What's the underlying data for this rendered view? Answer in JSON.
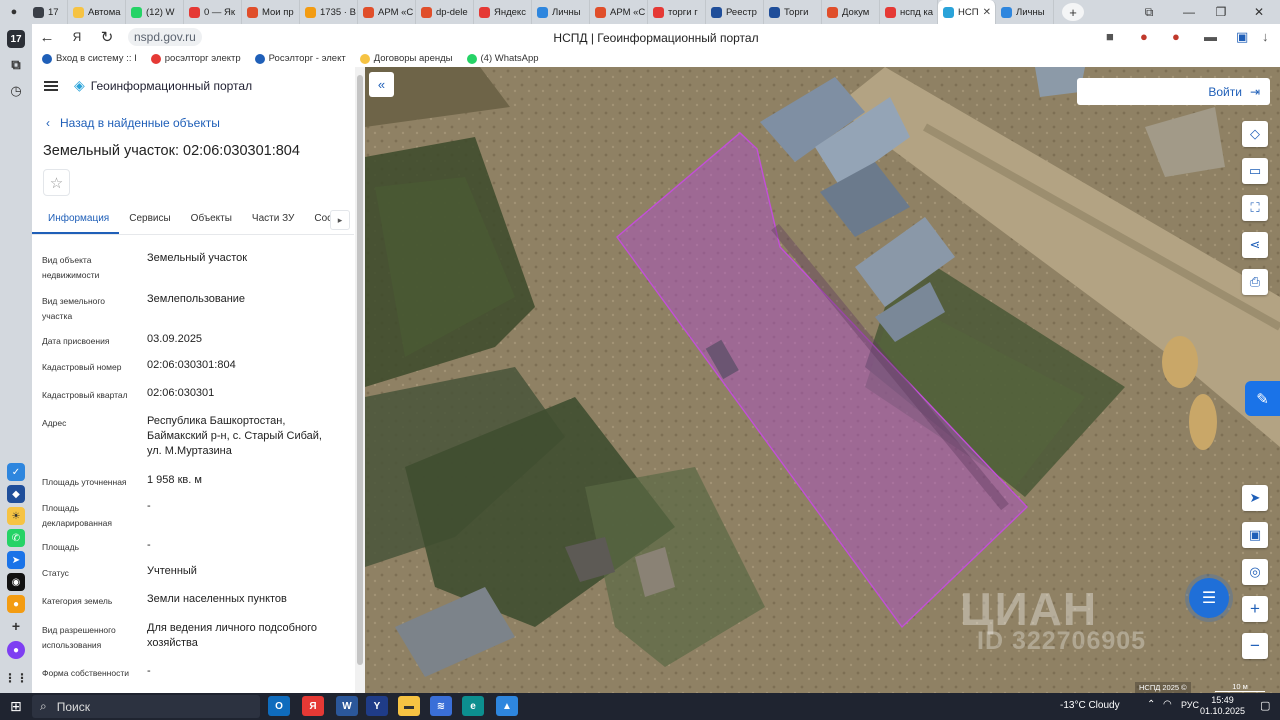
{
  "browser": {
    "tabs": [
      {
        "label": "17",
        "color": "#3a3f47"
      },
      {
        "label": "Автома",
        "color": "#f6c343"
      },
      {
        "label": "(12) W",
        "color": "#25d366"
      },
      {
        "label": "0 — Як",
        "color": "#e53935"
      },
      {
        "label": "Мои пр",
        "color": "#e04e2a"
      },
      {
        "label": "1735 · В",
        "color": "#f39c12"
      },
      {
        "label": "АРМ «С",
        "color": "#e04e2a"
      },
      {
        "label": "dp-dele",
        "color": "#e04e2a"
      },
      {
        "label": "Яндекс",
        "color": "#e53935"
      },
      {
        "label": "Личны",
        "color": "#2e86de"
      },
      {
        "label": "АРМ «С",
        "color": "#e04e2a"
      },
      {
        "label": "торги г",
        "color": "#e53935"
      },
      {
        "label": "Реестр",
        "color": "#1f4e9a"
      },
      {
        "label": "Торги",
        "color": "#1f4e9a"
      },
      {
        "label": "Докум",
        "color": "#e04e2a"
      },
      {
        "label": "нспд ка",
        "color": "#e53935"
      },
      {
        "label": "НСП",
        "color": "#2aa3d9",
        "active": true
      },
      {
        "label": "Личны",
        "color": "#2e86de"
      }
    ],
    "url": "nspd.gov.ru",
    "page_title": "НСПД | Геоинформационный портал",
    "bookmarks": [
      {
        "label": "Вход в систему :: I",
        "color": "#1f5fb8"
      },
      {
        "label": "росэлторг электр",
        "color": "#e53935"
      },
      {
        "label": "Росэлторг - элект",
        "color": "#1f5fb8"
      },
      {
        "label": "Договоры аренды",
        "color": "#f6c343"
      },
      {
        "label": "(4) WhatsApp",
        "color": "#25d366"
      }
    ]
  },
  "panel": {
    "portal_name": "Геоинформационный портал",
    "back_link": "Назад в найденные объекты",
    "object_title": "Земельный участок: 02:06:030301:804",
    "tabs": [
      "Информация",
      "Сервисы",
      "Объекты",
      "Части ЗУ",
      "Соста"
    ],
    "fields": [
      {
        "label": "Вид объекта недвижимости",
        "value": "Земельный участок"
      },
      {
        "label": "Вид земельного участка",
        "value": "Землепользование"
      },
      {
        "label": "Дата присвоения",
        "value": "03.09.2025"
      },
      {
        "label": "Кадастровый номер",
        "value": "02:06:030301:804"
      },
      {
        "label": "Кадастровый квартал",
        "value": "02:06:030301"
      },
      {
        "label": "Адрес",
        "value": "Республика Башкортостан, Баймакский р-н, с. Старый Сибай, ул. М.Муртазина"
      },
      {
        "label": "Площадь уточненная",
        "value": "1 958 кв. м"
      },
      {
        "label": "Площадь декларированная",
        "value": "-"
      },
      {
        "label": "Площадь",
        "value": "-"
      },
      {
        "label": "Статус",
        "value": "Учтенный"
      },
      {
        "label": "Категория земель",
        "value": "Земли населенных пунктов"
      },
      {
        "label": "Вид разрешенного использования",
        "value": "Для ведения личного подсобного хозяйства"
      },
      {
        "label": "Форма собственности",
        "value": "-"
      }
    ]
  },
  "map": {
    "login_label": "Войти",
    "copyright": "НСПД 2025 ©",
    "scale": "10 м",
    "watermark_line1": "ЦИАН",
    "watermark_line2": "ID 322706905",
    "parcel_color": "#b04fc8"
  },
  "taskbar": {
    "search_label": "Поиск",
    "weather": "-13°C Cloudy",
    "lang": "РУС",
    "time": "15:49",
    "date": "01.10.2025"
  }
}
